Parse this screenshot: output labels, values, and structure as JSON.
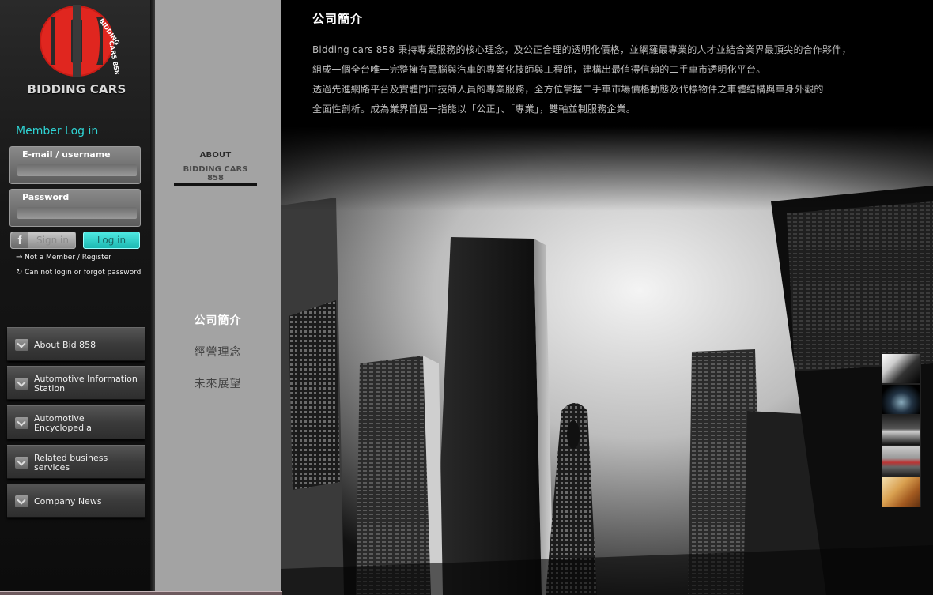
{
  "brand": {
    "logo_letters": "BD",
    "logo_arc_text": "BIDDING CARS 858",
    "name": "BIDDING CARS",
    "colors": {
      "logo_red": "#e0261f",
      "logo_dark": "#3a3a3a",
      "accent_cyan": "#2fd4d4"
    }
  },
  "login": {
    "title": "Member Log in",
    "email_label": "E-mail / username",
    "email_value": "",
    "password_label": "Password",
    "password_value": "",
    "fb_icon": "facebook-icon",
    "fb_label": "Sign in",
    "login_label": "Log in",
    "register_label": "Not a Member / Register",
    "register_icon": "arrow-right-icon",
    "forgot_label": "Can not login or forgot password",
    "forgot_icon": "refresh-icon"
  },
  "nav": {
    "items": [
      {
        "label": "About Bid 858",
        "icon": "chevron-down-icon"
      },
      {
        "label": "Automotive Information Station",
        "icon": "chevron-down-icon"
      },
      {
        "label": "Automotive Encyclopedia",
        "icon": "chevron-down-icon"
      },
      {
        "label": "Related business services",
        "icon": "chevron-down-icon"
      },
      {
        "label": "Company News",
        "icon": "chevron-down-icon"
      }
    ]
  },
  "section": {
    "title_line1": "ABOUT",
    "title_line2": "BIDDING CARS 858",
    "subnav": [
      "公司簡介",
      "經營理念",
      "未來展望"
    ],
    "active_index": 0
  },
  "content": {
    "title": "公司簡介",
    "lines": [
      "Bidding cars 858 秉持專業服務的核心理念，及公正合理的透明化價格，並網羅最專業的人才並結合業界最頂尖的合作夥伴，",
      "組成一個全台唯一完整擁有電腦與汽車的專業化技師與工程師，建構出最值得信賴的二手車市透明化平台。",
      "透過先進網路平台及實體門市技師人員的專業服務，全方位掌握二手車市場價格動態及代標物件之車體結構與車身外觀的",
      "全面性剖析。成為業界首屈一指能以「公正」、「專業」，雙軸並制服務企業。"
    ]
  },
  "gallery": {
    "thumbnails": [
      "thumbnail-1",
      "thumbnail-2",
      "thumbnail-3",
      "thumbnail-4",
      "thumbnail-5"
    ]
  }
}
